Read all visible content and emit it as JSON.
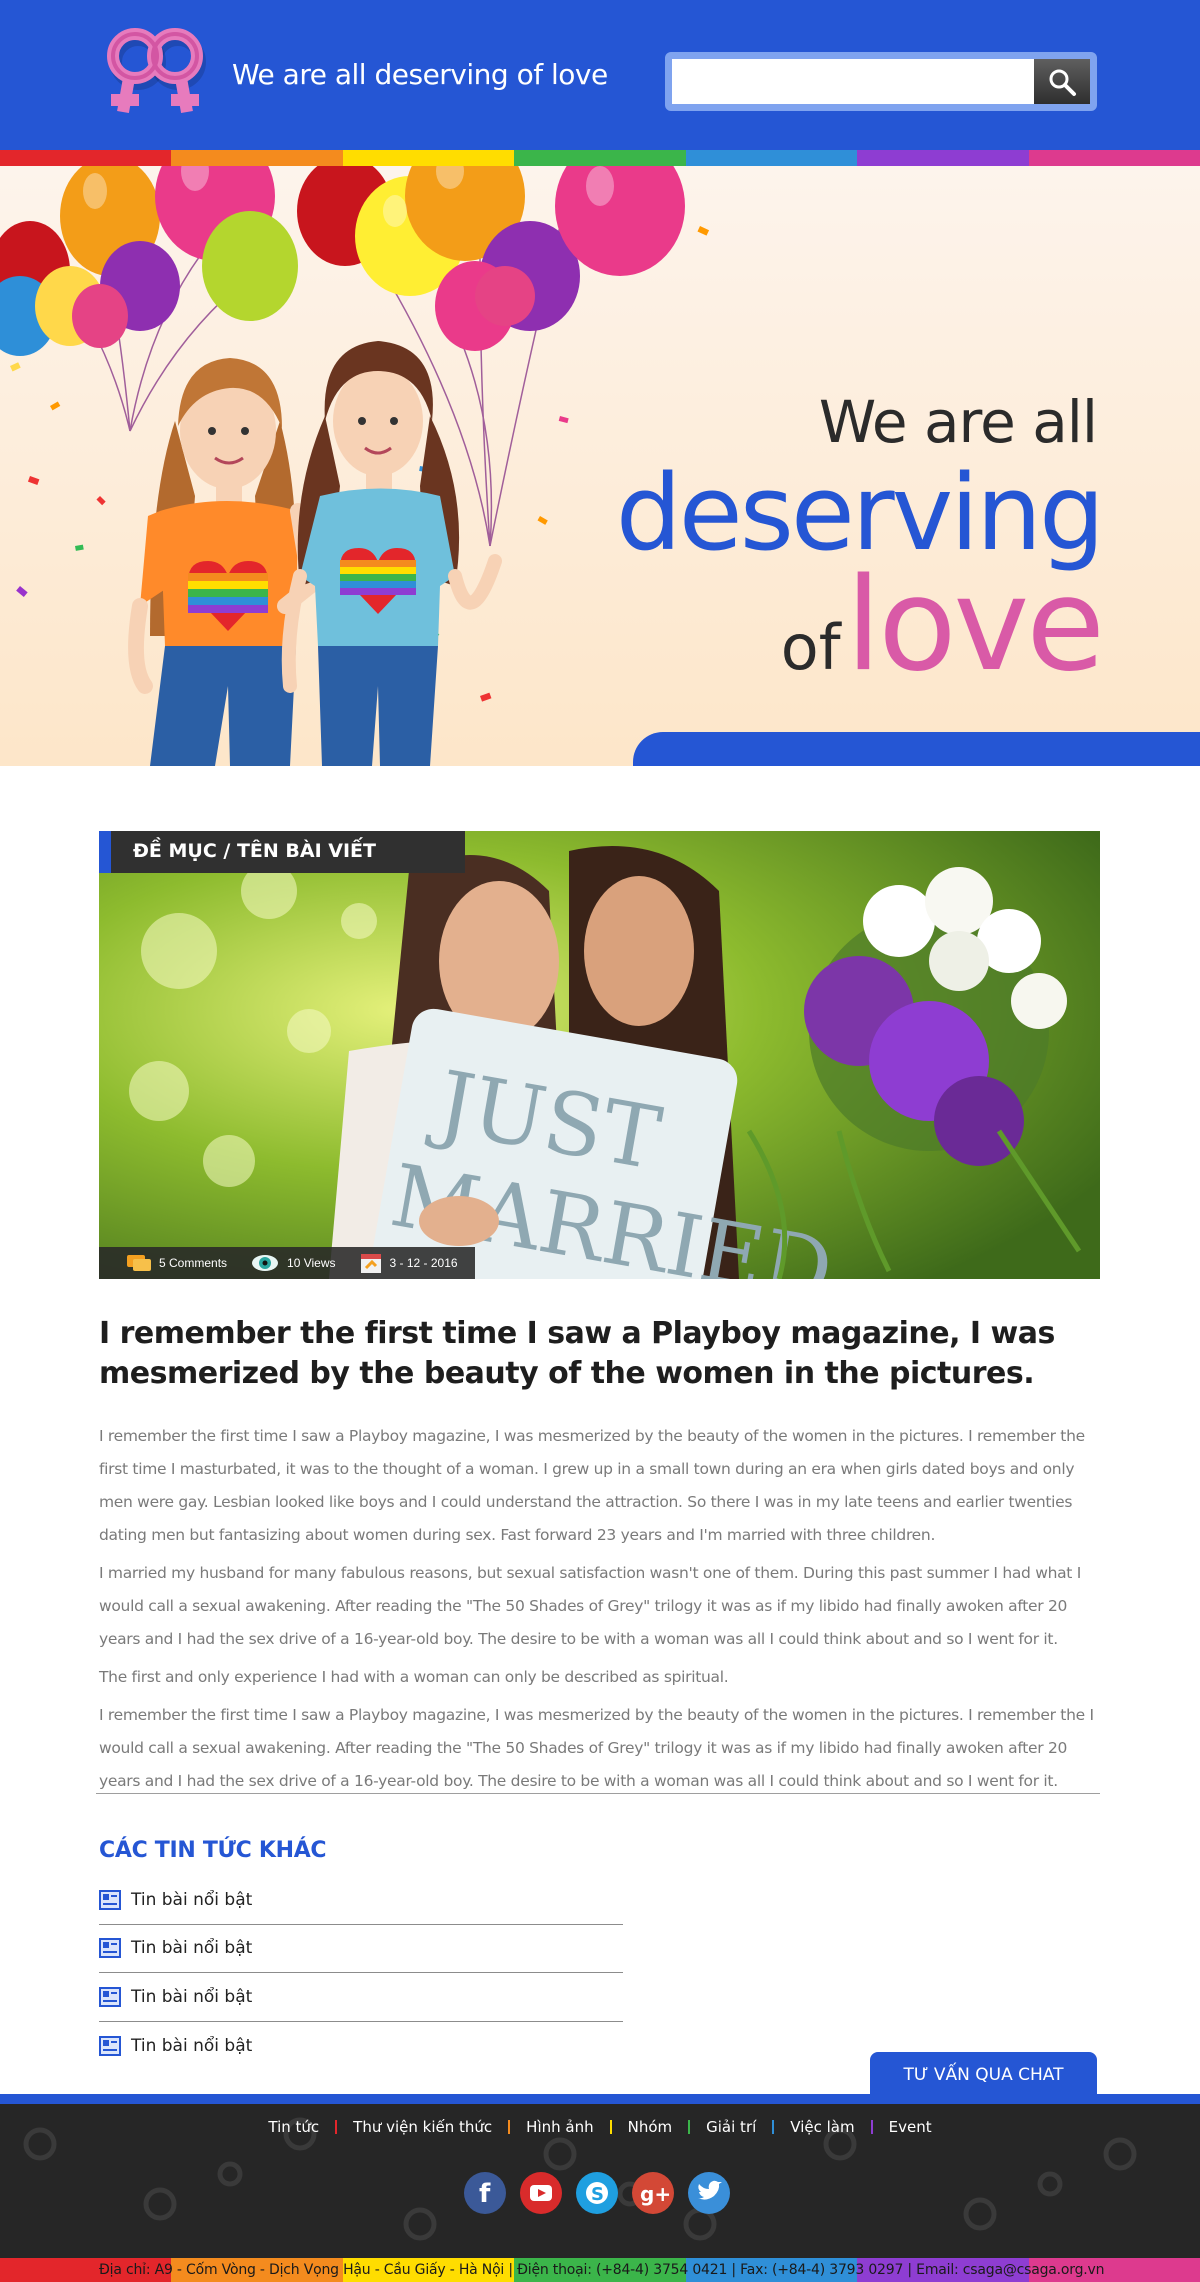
{
  "header": {
    "tagline_light": "We are ",
    "tagline_bold": "all deserving of love",
    "search": {
      "value": "",
      "placeholder": ""
    },
    "search_button_icon": "search-icon"
  },
  "rainbow_colors": [
    "#e3262b",
    "#f48b1e",
    "#ffdd00",
    "#3bb54a",
    "#2f8fd8",
    "#8e3dd2",
    "#dd3a8e"
  ],
  "hero": {
    "line1": "We are all",
    "line2": "deserving",
    "line3_of": "of",
    "line3_love": "love"
  },
  "article": {
    "category": "ĐỀ MỤC / TÊN BÀI VIẾT",
    "meta": {
      "comments": "5 Comments",
      "views": "10 Views",
      "date": "3 - 12 - 2016"
    },
    "title": "I remember the first time I saw a Playboy magazine, I was mesmerized by the beauty of the women in the pictures.",
    "paragraphs": [
      "I remember the first time I saw a Playboy magazine, I was mesmerized by the beauty of the women in the pictures. I remember the first time I masturbated, it was to the thought of a woman. I grew up in a small town during an era when girls dated boys and only men were gay. Lesbian looked like boys and I could understand the attraction. So there I was in my late teens and earlier twenties dating men but fantasizing about women during sex. Fast forward 23 years and I'm married with three children.",
      "I married my husband for many fabulous reasons, but sexual satisfaction wasn't one of them. During this past summer I had what I would call a sexual awakening. After reading the \"The 50 Shades of Grey\" trilogy it was as if my libido had finally awoken after 20 years and I had the sex drive of a 16-year-old boy. The desire to be with a woman was all I could think about and so I went for it.",
      "The first and only experience I had with a woman can only be described as spiritual.",
      "I remember the first time I saw a Playboy magazine, I was mesmerized by the beauty of the women in the pictures. I remember the I would call a sexual awakening. After reading the \"The 50 Shades of Grey\" trilogy it was as if my libido had finally awoken after 20 years and I had the sex drive of a 16-year-old boy. The desire to be with a woman was all I could think about and so I went for it."
    ]
  },
  "other_news": {
    "title": "CÁC TIN TỨC KHÁC",
    "items": [
      "Tin bài nổi bật",
      "Tin bài nổi bật",
      "Tin bài nổi bật",
      "Tin bài nổi bật"
    ]
  },
  "chat_button": "TƯ VẤN QUA CHAT",
  "footer": {
    "nav": [
      "Tin tức",
      "Thư viện kiến thức",
      "Hình ảnh",
      "Nhóm",
      "Giải trí",
      "Việc làm",
      "Event"
    ],
    "nav_separator_colors": [
      "#e3262b",
      "#f48b1e",
      "#ffdd00",
      "#3bb54a",
      "#2f8fd8",
      "#8e3dd2"
    ],
    "social": [
      {
        "name": "facebook-icon",
        "color": "#3b5998"
      },
      {
        "name": "youtube-icon",
        "color": "#d92b2b"
      },
      {
        "name": "skype-icon",
        "color": "#1f9fe0"
      },
      {
        "name": "google-plus-icon",
        "color": "#d34836"
      },
      {
        "name": "twitter-icon",
        "color": "#3a8fd9"
      }
    ],
    "address": "Địa chỉ: A9 - Cốm Vòng - Dịch Vọng Hậu - Cầu Giấy - Hà Nội  |  Điện thoại: (+84-4) 3754 0421  |  Fax: (+84-4) 3793 0297  |  Email: csaga@csaga.org.vn"
  }
}
